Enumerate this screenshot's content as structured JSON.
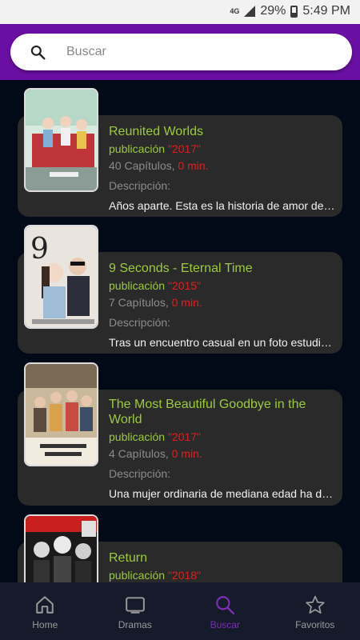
{
  "status": {
    "network": "4G",
    "battery": "29%",
    "time": "5:49 PM"
  },
  "search": {
    "placeholder": "Buscar"
  },
  "dramas": [
    {
      "title": "Reunited Worlds",
      "pub_label": "publicación ",
      "year": "\"2017\"",
      "chapters": "40 Capítulos,",
      "minutes": "0 min.",
      "desc_label": "Descripción:",
      "description": "Años aparte. Esta es la historia de amor de ..."
    },
    {
      "title": "9 Seconds - Eternal Time",
      "pub_label": "publicación ",
      "year": "\"2015\"",
      "chapters": "7 Capítulos,",
      "minutes": "0 min.",
      "desc_label": "Descripción:",
      "description": "Tras un encuentro casual en un foto estudio..."
    },
    {
      "title": "The Most Beautiful Goodbye in the World",
      "pub_label": "publicación ",
      "year": "\"2017\"",
      "chapters": "4 Capítulos,",
      "minutes": "0 min.",
      "desc_label": "Descripción:",
      "description": "Una mujer ordinaria de mediana edad ha de..."
    },
    {
      "title": "Return",
      "pub_label": "publicación ",
      "year": "\"2018\""
    }
  ],
  "nav": [
    {
      "label": "Home",
      "icon": "home-icon"
    },
    {
      "label": "Dramas",
      "icon": "tv-icon"
    },
    {
      "label": "Buscar",
      "icon": "search-icon"
    },
    {
      "label": "Favoritos",
      "icon": "star-icon"
    }
  ],
  "colors": {
    "header": "#6a0fa3",
    "accent": "#9ccc3d",
    "highlight": "#e02020",
    "active_nav": "#7d2fb3"
  }
}
